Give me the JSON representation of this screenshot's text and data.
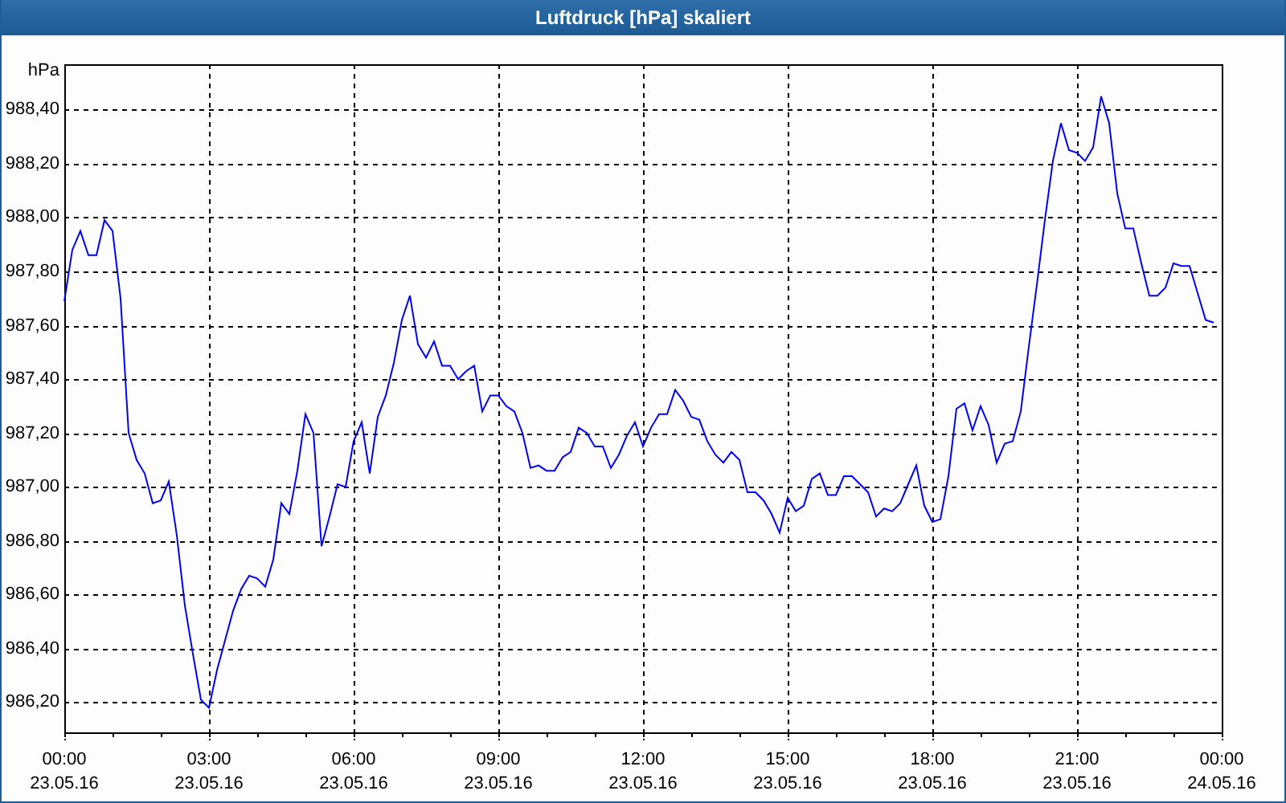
{
  "window": {
    "title": "Luftdruck [hPa] skaliert"
  },
  "chart": {
    "chart_data": {
      "type": "line",
      "grid": true,
      "ylabel": "hPa",
      "ylim": [
        986.089,
        988.569
      ],
      "yticks": [
        {
          "value": 986.2,
          "label": "986,20"
        },
        {
          "value": 986.4,
          "label": "986,40"
        },
        {
          "value": 986.6,
          "label": "986,60"
        },
        {
          "value": 986.8,
          "label": "986,80"
        },
        {
          "value": 987.0,
          "label": "987,00"
        },
        {
          "value": 987.2,
          "label": "987,20"
        },
        {
          "value": 987.4,
          "label": "987,40"
        },
        {
          "value": 987.6,
          "label": "987,60"
        },
        {
          "value": 987.8,
          "label": "987,80"
        },
        {
          "value": 988.0,
          "label": "988,00"
        },
        {
          "value": 988.2,
          "label": "988,20"
        },
        {
          "value": 988.4,
          "label": "988,40"
        }
      ],
      "categories": [
        "00:00\n23.05.16",
        null,
        null,
        null,
        null,
        null,
        null,
        null,
        null,
        null,
        null,
        null,
        null,
        null,
        null,
        null,
        null,
        null,
        "03:00\n23.05.16",
        null,
        null,
        null,
        null,
        null,
        null,
        null,
        null,
        null,
        null,
        null,
        null,
        null,
        null,
        null,
        null,
        null,
        "06:00\n23.05.16",
        null,
        null,
        null,
        null,
        null,
        null,
        null,
        null,
        null,
        null,
        null,
        null,
        null,
        null,
        null,
        null,
        null,
        "09:00\n23.05.16",
        null,
        null,
        null,
        null,
        null,
        null,
        null,
        null,
        null,
        null,
        null,
        null,
        null,
        null,
        null,
        null,
        null,
        "12:00\n23.05.16",
        null,
        null,
        null,
        null,
        null,
        null,
        null,
        null,
        null,
        null,
        null,
        null,
        null,
        null,
        null,
        null,
        null,
        "15:00\n23.05.16",
        null,
        null,
        null,
        null,
        null,
        null,
        null,
        null,
        null,
        null,
        null,
        null,
        null,
        null,
        null,
        null,
        null,
        "18:00\n23.05.16",
        null,
        null,
        null,
        null,
        null,
        null,
        null,
        null,
        null,
        null,
        null,
        null,
        null,
        null,
        null,
        null,
        null,
        "21:00\n23.05.16",
        null,
        null,
        null,
        null,
        null,
        null,
        null,
        null,
        null,
        null,
        null,
        null,
        null,
        null,
        null,
        null,
        null,
        "00:00\n24.05.16"
      ],
      "series": [
        {
          "color": "#0000ff",
          "values": [
            987.69,
            987.88,
            987.95,
            987.86,
            987.86,
            987.99,
            987.95,
            987.7,
            987.2,
            987.1,
            987.05,
            986.94,
            986.95,
            987.02,
            986.82,
            986.56,
            986.38,
            986.21,
            986.18,
            986.32,
            986.43,
            986.54,
            986.62,
            986.67,
            986.66,
            986.63,
            986.73,
            986.94,
            986.9,
            987.06,
            987.27,
            987.2,
            986.78,
            986.89,
            987.01,
            987.0,
            987.17,
            987.24,
            987.05,
            987.26,
            987.34,
            987.46,
            987.62,
            987.71,
            987.53,
            987.48,
            987.54,
            987.45,
            987.45,
            987.4,
            987.43,
            987.45,
            987.28,
            987.34,
            987.34,
            987.3,
            987.28,
            987.2,
            987.07,
            987.08,
            987.06,
            987.06,
            987.11,
            987.13,
            987.22,
            987.2,
            987.15,
            987.15,
            987.07,
            987.12,
            987.19,
            987.24,
            987.15,
            987.22,
            987.27,
            987.27,
            987.36,
            987.32,
            987.26,
            987.25,
            987.17,
            987.12,
            987.09,
            987.13,
            987.1,
            986.98,
            986.98,
            986.95,
            986.9,
            986.83,
            986.96,
            986.91,
            986.93,
            987.03,
            987.05,
            986.97,
            986.97,
            987.04,
            987.04,
            987.01,
            986.98,
            986.89,
            986.92,
            986.91,
            986.94,
            987.01,
            987.08,
            986.93,
            986.87,
            986.88,
            987.04,
            987.29,
            987.31,
            987.21,
            987.3,
            987.23,
            987.09,
            987.16,
            987.17,
            987.28,
            987.52,
            987.75,
            987.99,
            988.21,
            988.35,
            988.25,
            988.24,
            988.21,
            988.26,
            988.45,
            988.35,
            988.09,
            987.96,
            987.96,
            987.83,
            987.71,
            987.71,
            987.74,
            987.83,
            987.82,
            987.82,
            987.72,
            987.62,
            987.61,
            null
          ]
        }
      ]
    }
  }
}
